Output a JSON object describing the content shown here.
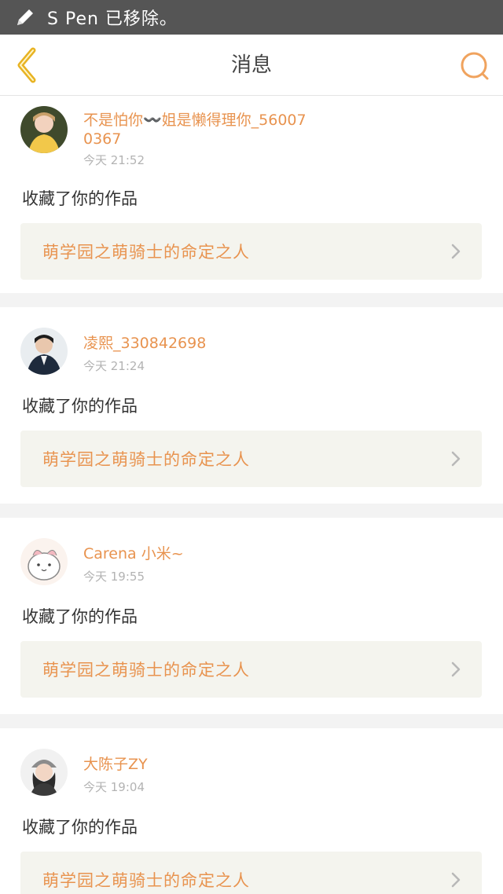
{
  "status_bar": {
    "text": "S Pen 已移除。",
    "icon": "pen-icon"
  },
  "nav": {
    "title": "消息",
    "back_icon": "chevron-left-icon",
    "search_icon": "search-icon"
  },
  "colors": {
    "accent": "#e8934f",
    "back_arrow": "#e8b323",
    "link_bg": "#f4f4ee",
    "divider": "#f3f3f3"
  },
  "notifications": [
    {
      "username": "不是怕你〰️姐是懒得理你_560070367",
      "time": "今天 21:52",
      "action": "收藏了你的作品",
      "work_title": "萌学园之萌骑士的命定之人"
    },
    {
      "username": "凌熙_330842698",
      "time": "今天 21:24",
      "action": "收藏了你的作品",
      "work_title": "萌学园之萌骑士的命定之人"
    },
    {
      "username": "Carena 小米~",
      "time": "今天 19:55",
      "action": "收藏了你的作品",
      "work_title": "萌学园之萌骑士的命定之人"
    },
    {
      "username": "大陈子ZY",
      "time": "今天 19:04",
      "action": "收藏了你的作品",
      "work_title": "萌学园之萌骑士的命定之人"
    }
  ]
}
